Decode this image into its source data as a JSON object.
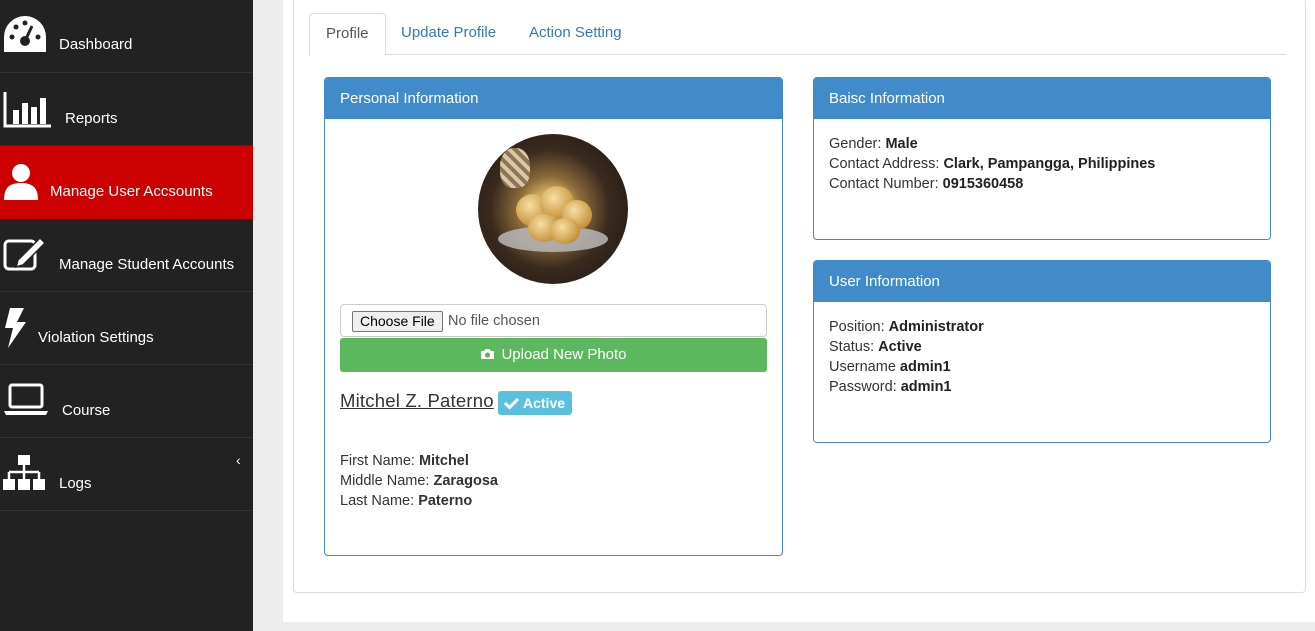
{
  "sidebar": {
    "items": [
      {
        "label": "Dashboard",
        "icon": "dashboard-icon",
        "active": false
      },
      {
        "label": "Reports",
        "icon": "bar-chart-icon",
        "active": false
      },
      {
        "label": "Manage User Accsounts",
        "icon": "user-icon",
        "active": true
      },
      {
        "label": "Manage Student Accounts",
        "icon": "edit-icon",
        "active": false
      },
      {
        "label": "Violation Settings",
        "icon": "bolt-icon",
        "active": false
      },
      {
        "label": "Course",
        "icon": "laptop-icon",
        "active": false
      },
      {
        "label": "Logs",
        "icon": "sitemap-icon",
        "active": false
      }
    ],
    "chevron": "‹"
  },
  "tabs": [
    {
      "label": "Profile",
      "active": true
    },
    {
      "label": "Update Profile",
      "active": false
    },
    {
      "label": "Action Setting",
      "active": false
    }
  ],
  "personal": {
    "title": "Personal Information",
    "file_button": "Choose File",
    "file_status": "No file chosen",
    "upload_label": "Upload New Photo",
    "full_name": "Mitchel Z. Paterno",
    "status_badge": "Active",
    "first_label": "First Name:",
    "first_value": "Mitchel",
    "middle_label": "Middle Name:",
    "middle_value": "Zaragosa",
    "last_label": "Last Name:",
    "last_value": "Paterno"
  },
  "basic": {
    "title": "Baisc Information",
    "gender_label": "Gender:",
    "gender_value": "Male",
    "address_label": "Contact Address:",
    "address_value": "Clark, Pampangga, Philippines",
    "number_label": "Contact Number:",
    "number_value": "0915360458"
  },
  "user": {
    "title": "User Information",
    "position_label": "Position:",
    "position_value": "Administrator",
    "status_label": "Status:",
    "status_value": "Active",
    "username_label": "Username",
    "username_value": "admin1",
    "password_label": "Password:",
    "password_value": "admin1"
  },
  "colors": {
    "sidebar_bg": "#222222",
    "active_nav": "#cc0000",
    "panel_primary": "#428bca",
    "success": "#5cb85c",
    "info": "#5bc0de",
    "link": "#337ab7"
  }
}
